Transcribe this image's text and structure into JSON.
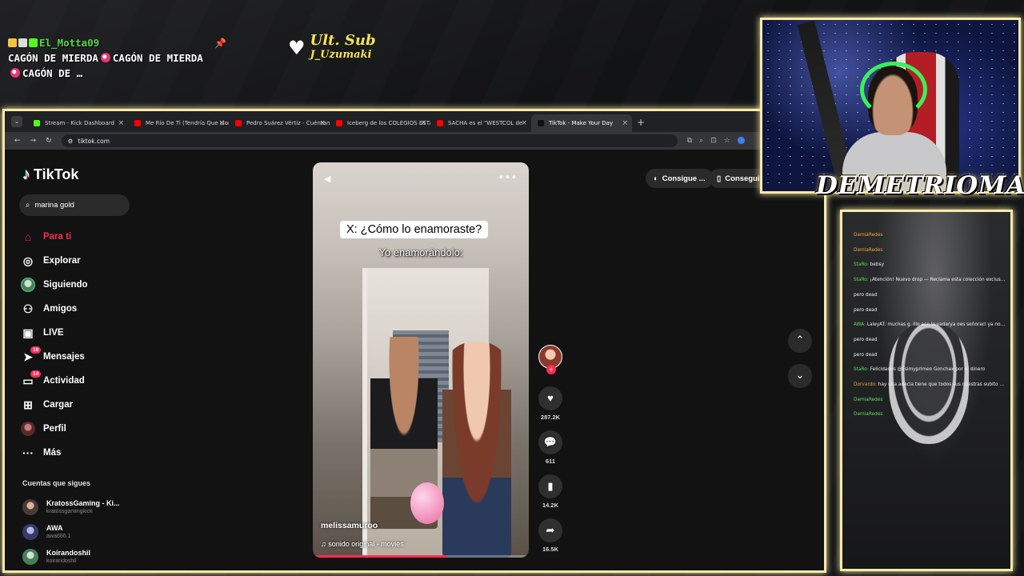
{
  "overlay": {
    "chat_user": "El_Motta09",
    "chat_lines": [
      "CAGÓN DE MIERDA",
      "CAGÓN DE MIERDA",
      "CAGÓN DE",
      "MIERDA",
      "CAGÓN DE MIERDA"
    ],
    "ult_sub_title": "Ult. Sub",
    "ult_sub_name": "J_Uzumaki",
    "streamer_name": "DEMETRIOMAN"
  },
  "browser": {
    "tabs": [
      {
        "label": "Stream - Kick Dashboard",
        "color": "#53fc18"
      },
      {
        "label": "Me Río De Ti (Tendría Que Llor",
        "color": "#ff0000"
      },
      {
        "label": "Pedro Suárez Vértiz - Cuéntam",
        "color": "#ff0000"
      },
      {
        "label": "Iceberg de los COLEGIOS ESTA",
        "color": "#ff0000"
      },
      {
        "label": "SACHA es el \"WESTCOL de",
        "color": "#ff0000"
      },
      {
        "label": "TikTok - Make Your Day",
        "color": "#111111"
      }
    ],
    "url": "tiktok.com"
  },
  "tiktok": {
    "logo": "TikTok",
    "search_value": "marina gold",
    "nav": [
      {
        "label": "Para ti",
        "icon": "home-icon"
      },
      {
        "label": "Explorar",
        "icon": "compass-icon"
      },
      {
        "label": "Siguiendo",
        "icon": "following-avatar-icon"
      },
      {
        "label": "Amigos",
        "icon": "friends-icon"
      },
      {
        "label": "LIVE",
        "icon": "live-tv-icon"
      },
      {
        "label": "Mensajes",
        "icon": "messages-icon",
        "count": "18"
      },
      {
        "label": "Actividad",
        "icon": "activity-icon",
        "count": "14"
      },
      {
        "label": "Cargar",
        "icon": "upload-icon"
      },
      {
        "label": "Perfil",
        "icon": "profile-avatar-icon"
      },
      {
        "label": "Más",
        "icon": "more-icon"
      }
    ],
    "following_title": "Cuentas que sigues",
    "accounts": [
      {
        "name": "KratossGaming - Ki...",
        "handle": "kratossgamingkick"
      },
      {
        "name": "AWA",
        "handle": "awa666.1"
      },
      {
        "name": "Koirandoshil",
        "handle": "koirandoshil"
      }
    ],
    "video": {
      "caption_box": "X: ¿Cómo lo enamoraste?",
      "caption_sub": "Yo enamorándolo:",
      "username": "melissamuroo",
      "sound": "sonido original - movies",
      "progress": 0.62
    },
    "actions": {
      "likes": "287.2K",
      "comments": "611",
      "saves": "14.2K",
      "shares": "16.5K"
    },
    "pills": [
      "Consigue ...",
      "Consegui"
    ]
  },
  "chat_panel": {
    "lines": [
      {
        "user": "DemiaRedes",
        "text": "",
        "color": "o"
      },
      {
        "user": "DemiaRedes",
        "text": "",
        "color": "o"
      },
      {
        "user": "",
        "text": "",
        "color": "r"
      },
      {
        "user": "StaRo:",
        "text": "bebsy",
        "color": "g"
      },
      {
        "user": "StaRo:",
        "text": "¡Atención! Nuevo drop — Reclama esta colección exclusiva en el chat lo más rápido posible para ganarlo 6 - 6 + 1",
        "color": "g"
      },
      {
        "user": "",
        "text": "pero dead",
        "color": "o"
      },
      {
        "user": "",
        "text": "pero dead",
        "color": "o"
      },
      {
        "user": "AWA:",
        "text": "LaleyAT: muchas g. lile ace la vadarya oes señoracl ya no está la señorarme",
        "color": "g"
      },
      {
        "user": "",
        "text": "pero dead",
        "color": "o"
      },
      {
        "user": "",
        "text": "pero dead",
        "color": "o"
      },
      {
        "user": "",
        "text": "",
        "color": "r"
      },
      {
        "user": "StaRo:",
        "text": "Felicidades @Esimyprimeo Gonchex por el dinero",
        "color": "g"
      },
      {
        "user": "Dorvardo:",
        "text": "hay una adecia tiene que todos sus nuestras subito a defender de la ejuda",
        "color": "o"
      },
      {
        "user": "DemiaRedes",
        "text": "",
        "color": "g"
      },
      {
        "user": "DemiaRedes",
        "text": "",
        "color": "g"
      },
      {
        "user": "",
        "text": "",
        "color": "r"
      },
      {
        "user": "",
        "text": "",
        "color": "r"
      },
      {
        "user": "",
        "text": "",
        "color": "r"
      },
      {
        "user": "",
        "text": "",
        "color": "r"
      },
      {
        "user": "",
        "text": "",
        "color": "r"
      },
      {
        "user": "",
        "text": "",
        "color": "r"
      },
      {
        "user": "",
        "text": "",
        "color": "r"
      }
    ]
  }
}
